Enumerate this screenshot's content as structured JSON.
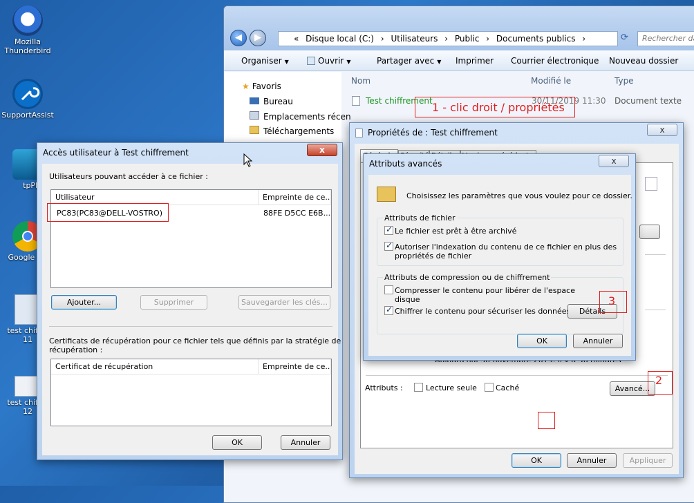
{
  "desktop": {
    "icons": [
      {
        "label1": "Mozilla",
        "label2": "Thunderbird"
      },
      {
        "label1": "SupportAssist",
        "label2": ""
      },
      {
        "label1": "tpPLC",
        "label2": ""
      },
      {
        "label1": "Google Ch",
        "label2": ""
      },
      {
        "label1": "test chiffre",
        "label2": "11"
      },
      {
        "label1": "test chiffre",
        "label2": "12"
      }
    ]
  },
  "explorer": {
    "breadcrumb": [
      "«",
      "Disque local (C:)",
      "›",
      "Utilisateurs",
      "›",
      "Public",
      "›",
      "Documents publics",
      "›"
    ],
    "search_placeholder": "Rechercher dans",
    "toolbar": {
      "organiser": "Organiser",
      "ouvrir": "Ouvrir",
      "partager": "Partager avec",
      "imprimer": "Imprimer",
      "courrier": "Courrier électronique",
      "nouveau_dossier": "Nouveau dossier"
    },
    "nav": {
      "favoris": "Favoris",
      "bureau": "Bureau",
      "emplacements": "Emplacements récen",
      "telechargements": "Téléchargements"
    },
    "columns": {
      "nom": "Nom",
      "modifie": "Modifié le",
      "type": "Type"
    },
    "file": {
      "name": "Test chiffrement",
      "date": "30/11/2019 11:30",
      "type": "Document texte"
    }
  },
  "annotations": {
    "step1": "1 - clic droit / propriétés",
    "step2": "2",
    "step3": "3"
  },
  "access_dialog": {
    "title": "Accès utilisateur à Test chiffrement",
    "close": "x",
    "users_label": "Utilisateurs pouvant accéder à ce fichier :",
    "col_user": "Utilisateur",
    "col_print": "Empreinte de ce...",
    "user_name": "PC83(PC83@DELL-VOSTRO)",
    "user_print": "88FE D5CC E6B...",
    "btn_add": "Ajouter...",
    "btn_remove": "Supprimer",
    "btn_backup": "Sauvegarder les clés...",
    "recovery_label1": "Certificats de récupération pour ce fichier tels que définis par la stratégie de",
    "recovery_label2": "récupération :",
    "col_cert": "Certificat de récupération",
    "col_print2": "Empreinte de ce...",
    "ok": "OK",
    "cancel": "Annuler"
  },
  "props_dialog": {
    "title": "Propriétés de : Test chiffrement",
    "close": "x",
    "tabs": [
      "Général",
      "Sécurité",
      "Détails",
      "Versions précédentes"
    ],
    "partial_text": "Aujourd'hui 30 novembre 2019, il y a 56 minutes",
    "attrs_label": "Attributs :",
    "readonly": "Lecture seule",
    "hidden": "Caché",
    "advanced": "Avancé...",
    "ok": "OK",
    "cancel": "Annuler",
    "apply": "Appliquer"
  },
  "advanced_dialog": {
    "title": "Attributs avancés",
    "close": "x",
    "intro": "Choisissez les paramètres que vous voulez pour ce dossier.",
    "file_attrs_group": "Attributs de fichier",
    "archive": "Le fichier est prêt à être archivé",
    "index_line1": "Autoriser l'indexation du contenu de ce fichier en plus des",
    "index_line2": "propriétés de fichier",
    "compress_group": "Attributs de compression ou de chiffrement",
    "compress_line1": "Compresser le contenu pour libérer de l'espace",
    "compress_line2": "disque",
    "encrypt": "Chiffrer le contenu pour sécuriser les données",
    "details": "Détails",
    "ok": "OK",
    "cancel": "Annuler"
  }
}
